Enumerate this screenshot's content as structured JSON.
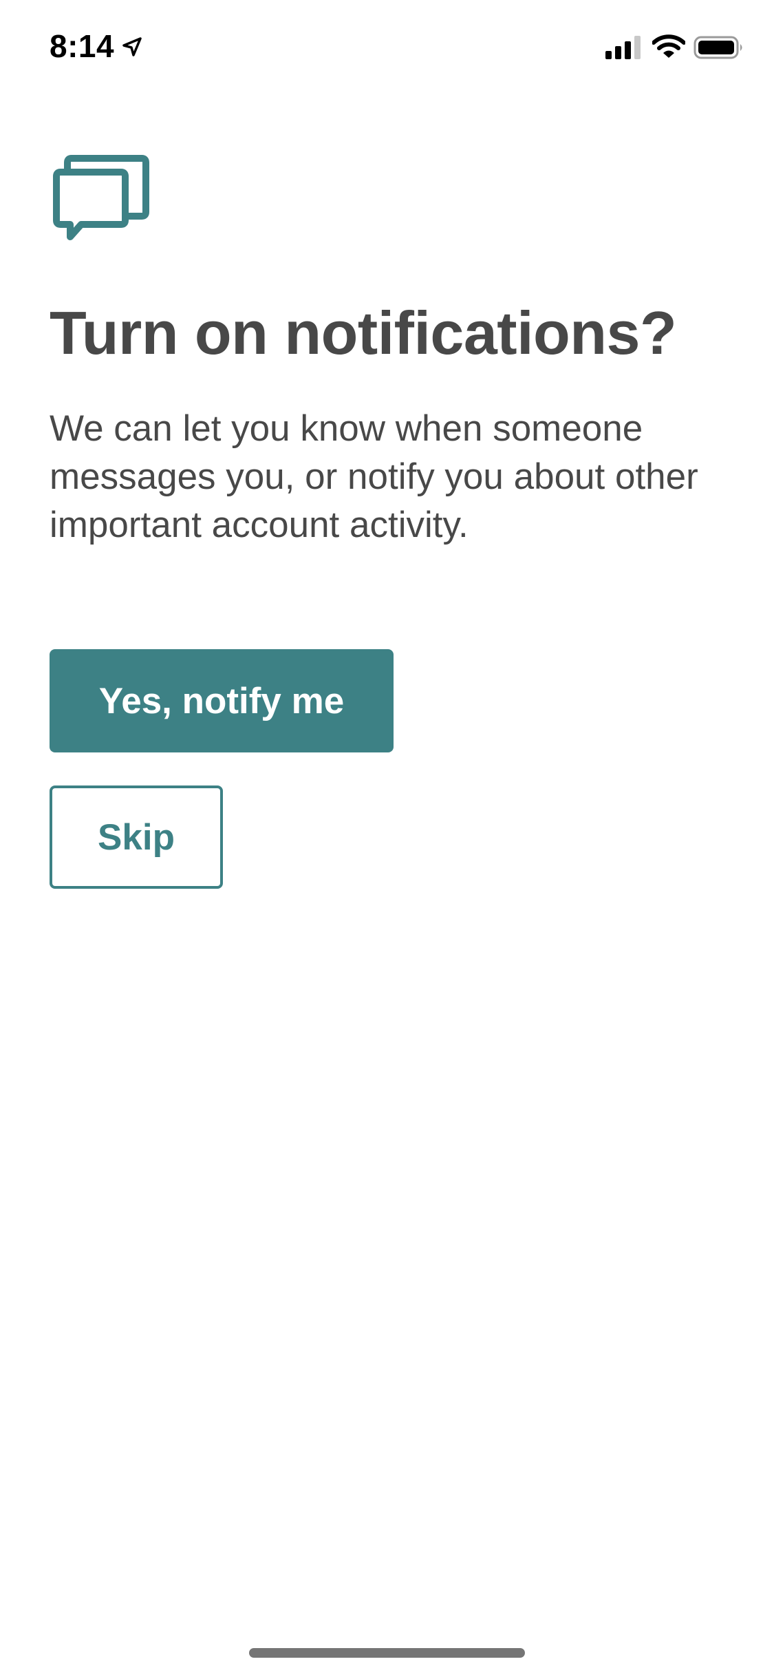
{
  "status_bar": {
    "time": "8:14",
    "icons": [
      "location-arrow-icon",
      "cellular-signal-icon",
      "wifi-icon",
      "battery-icon"
    ]
  },
  "content": {
    "icon": "chat-bubbles-icon",
    "title": "Turn on notifications?",
    "description": "We can let you know when someone messages you, or notify you about other important account activity."
  },
  "actions": {
    "primary_label": "Yes, notify me",
    "secondary_label": "Skip"
  },
  "colors": {
    "accent": "#3d8185",
    "text": "#484848",
    "background": "#ffffff"
  }
}
